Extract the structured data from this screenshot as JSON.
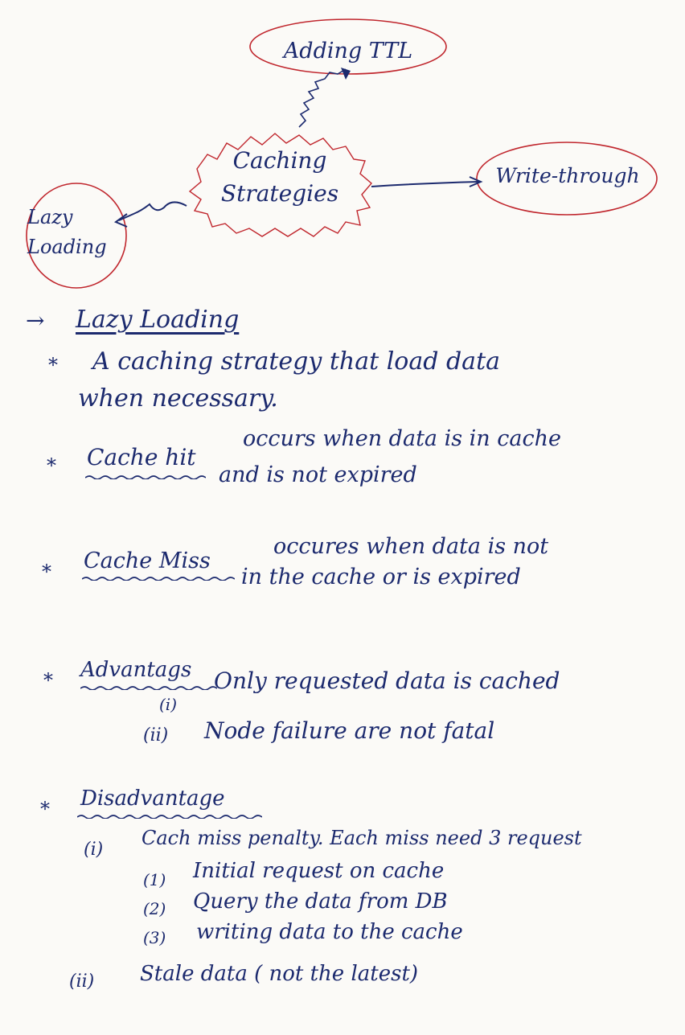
{
  "diagram": {
    "center": "Caching Strategies",
    "top": "Adding TTL",
    "right": "Write-through",
    "left": "Lazy Loading"
  },
  "notes": {
    "heading_arrow": "→",
    "heading": "Lazy Loading",
    "bullet": "*",
    "def_line1": "A caching strategy that load data",
    "def_line2": "when necessary.",
    "hit_term": "Cache hit",
    "hit_line1": "occurs when data is in cache",
    "hit_line2": "and is not expired",
    "miss_term": "Cache Miss",
    "miss_line1": "occures when data is not",
    "miss_line2": "in the cache or is expired",
    "adv_term": "Advantags",
    "adv_i_num": "(i)",
    "adv_i": "Only requested data is cached",
    "adv_ii_num": "(ii)",
    "adv_ii": "Node failure are not fatal",
    "dis_term": "Disadvantage",
    "dis_i_num": "(i)",
    "dis_i": "Cach miss penalty. Each miss need 3 request",
    "dis_1_num": "(1)",
    "dis_1": "Initial request on cache",
    "dis_2_num": "(2)",
    "dis_2": "Query the data from DB",
    "dis_3_num": "(3)",
    "dis_3": "writing data to the cache",
    "dis_ii_num": "(ii)",
    "dis_ii": "Stale data ( not the latest)"
  },
  "colors": {
    "ink": "#1c2a6e",
    "red_ink": "#c0262d",
    "paper": "#fbfaf7"
  }
}
